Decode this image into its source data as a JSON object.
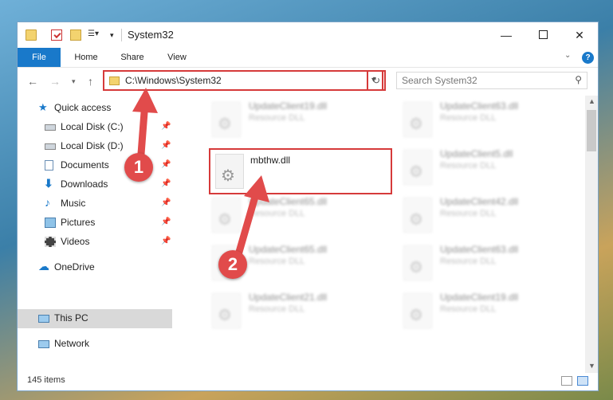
{
  "window": {
    "title": "System32",
    "minimize_glyph": "—",
    "close_glyph": "✕"
  },
  "quick_access_toolbar": {
    "dropdown_glyph": "▾",
    "customize_glyph": "☰▾"
  },
  "ribbon": {
    "tabs": [
      "File",
      "Home",
      "Share",
      "View"
    ],
    "expand_glyph": "⌄",
    "help_glyph": "?"
  },
  "nav": {
    "back_glyph": "←",
    "forward_glyph": "→",
    "recent_glyph": "▾",
    "up_glyph": "↑",
    "address": "C:\\Windows\\System32",
    "address_dropdown_glyph": "▾",
    "refresh_glyph": "↻",
    "search_placeholder": "Search System32",
    "search_glyph": "⚲"
  },
  "sidebar": {
    "quick_access": "Quick access",
    "items": [
      {
        "label": "Local Disk (C:)",
        "pinned": true
      },
      {
        "label": "Local Disk (D:)",
        "pinned": true
      },
      {
        "label": "Documents",
        "pinned": true
      },
      {
        "label": "Downloads",
        "pinned": true
      },
      {
        "label": "Music",
        "pinned": true
      },
      {
        "label": "Pictures",
        "pinned": true
      },
      {
        "label": "Videos",
        "pinned": true
      }
    ],
    "pin_glyph": "📌",
    "onedrive": "OneDrive",
    "this_pc": "This PC",
    "network": "Network"
  },
  "files": [
    {
      "name": "UpdateClient19.dll",
      "type": "Resource DLL"
    },
    {
      "name": "UpdateClient63.dll",
      "type": "Resource DLL"
    },
    {
      "name": "mbthw.dll",
      "type": ""
    },
    {
      "name": "UpdateClient5.dll",
      "type": "Resource DLL"
    },
    {
      "name": "UpdateClient65.dll",
      "type": "Resource DLL"
    },
    {
      "name": "UpdateClient42.dll",
      "type": "Resource DLL"
    },
    {
      "name": "UpdateClient65.dll",
      "type": "Resource DLL"
    },
    {
      "name": "UpdateClient63.dll",
      "type": "Resource DLL"
    },
    {
      "name": "UpdateClient21.dll",
      "type": "Resource DLL"
    },
    {
      "name": "UpdateClient19.dll",
      "type": "Resource DLL"
    }
  ],
  "gear_glyph": "⚙",
  "status": {
    "item_count": "145 items"
  },
  "scrollbar": {
    "up_glyph": "▲",
    "down_glyph": "▼"
  },
  "annotations": {
    "step1": "1",
    "step2": "2",
    "color": "#e14b4b"
  }
}
